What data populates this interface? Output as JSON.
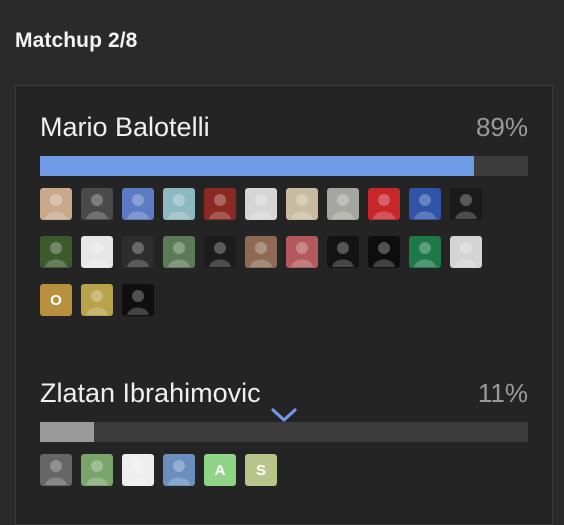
{
  "header": {
    "title": "Matchup 2/8"
  },
  "candidates": [
    {
      "name": "Mario Balotelli",
      "percent_label": "89%",
      "percent": 0.89,
      "bar_color": "#6f9ae6",
      "voters": [
        {
          "type": "photo",
          "bg": "#c9a98a"
        },
        {
          "type": "photo",
          "bg": "#4a4a4a"
        },
        {
          "type": "photo",
          "bg": "#5c7bc4"
        },
        {
          "type": "photo",
          "bg": "#8fb9c2"
        },
        {
          "type": "photo",
          "bg": "#8a2a22"
        },
        {
          "type": "photo",
          "bg": "#d6d6d6"
        },
        {
          "type": "photo",
          "bg": "#c8bba0"
        },
        {
          "type": "photo",
          "bg": "#a6a6a0"
        },
        {
          "type": "photo",
          "bg": "#c8262a"
        },
        {
          "type": "photo",
          "bg": "#2f54a8"
        },
        {
          "type": "photo",
          "bg": "#1a1a1a"
        },
        {
          "type": "photo",
          "bg": "#3d5a2e"
        },
        {
          "type": "photo",
          "bg": "#e7e7e7"
        },
        {
          "type": "photo",
          "bg": "#2e2e2e"
        },
        {
          "type": "photo",
          "bg": "#5c7a58"
        },
        {
          "type": "photo",
          "bg": "#1c1c1c"
        },
        {
          "type": "photo",
          "bg": "#8e6a55"
        },
        {
          "type": "photo",
          "bg": "#b3595c"
        },
        {
          "type": "photo",
          "bg": "#131313"
        },
        {
          "type": "photo",
          "bg": "#0e0e0e"
        },
        {
          "type": "photo",
          "bg": "#1d7a48"
        },
        {
          "type": "photo",
          "bg": "#d4d4d4"
        },
        {
          "type": "letter",
          "bg": "#b8913f",
          "text": "O"
        },
        {
          "type": "photo",
          "bg": "#b8a24a"
        },
        {
          "type": "photo",
          "bg": "#0f0f0f"
        }
      ]
    },
    {
      "name": "Zlatan Ibrahimovic",
      "percent_label": "11%",
      "percent": 0.11,
      "bar_color": "#9b9b9b",
      "voters": [
        {
          "type": "photo",
          "bg": "#666666"
        },
        {
          "type": "photo",
          "bg": "#7aa56a"
        },
        {
          "type": "photo",
          "bg": "#eeeeee"
        },
        {
          "type": "photo",
          "bg": "#6a8fbf"
        },
        {
          "type": "letter",
          "bg": "#90d488",
          "text": "A"
        },
        {
          "type": "letter",
          "bg": "#b7c58a",
          "text": "S"
        }
      ]
    }
  ]
}
